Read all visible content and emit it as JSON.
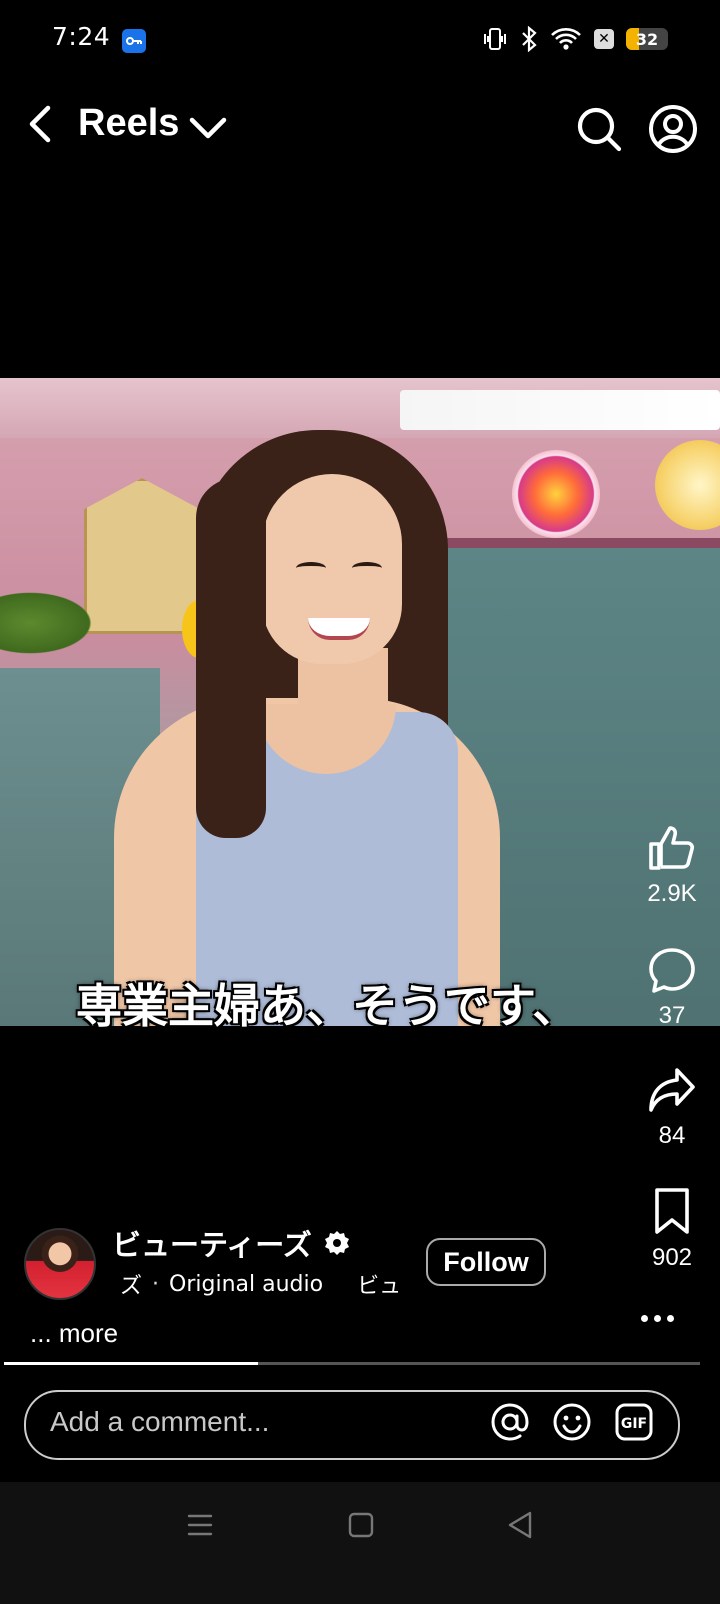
{
  "status_bar": {
    "time": "7:24",
    "battery_level": "32",
    "battery_fraction": 0.32,
    "icons": [
      "vpn-key-icon",
      "vibrate-icon",
      "bluetooth-icon",
      "wifi-icon",
      "close-box-icon",
      "battery-icon"
    ]
  },
  "header": {
    "title": "Reels",
    "icons": [
      "back-arrow-icon",
      "chevron-down-icon",
      "search-icon",
      "profile-icon"
    ]
  },
  "video": {
    "subtitle": "専業主婦あ、そうです、"
  },
  "actions": {
    "likes": "2.9K",
    "comments": "37",
    "shares": "84",
    "saves": "902"
  },
  "author": {
    "name": "ビューティーズ",
    "audio_prefix": "ズ",
    "separator": "·",
    "audio": "Original audio",
    "audio_suffix": "ビュ",
    "follow_label": "Follow",
    "more_label": "... more"
  },
  "progress": {
    "fraction": 0.365
  },
  "comment": {
    "placeholder": "Add a comment..."
  },
  "colors": {
    "background": "#000000",
    "vpn_badge": "#1a73e8",
    "battery_fill": "#f5b301"
  }
}
